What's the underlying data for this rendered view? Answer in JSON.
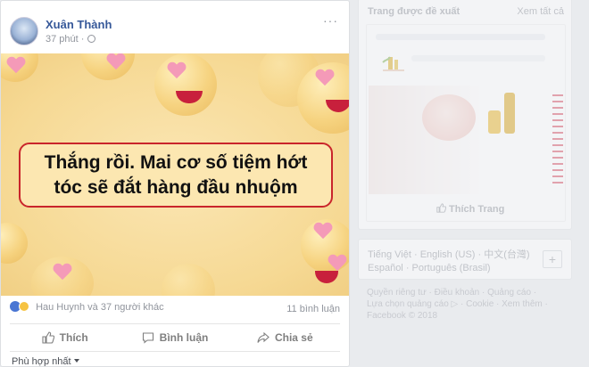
{
  "post": {
    "author": "Xuân Thành",
    "time": "37 phút",
    "more": "···",
    "caption_line1": "Thắng rồi. Mai cơ số tiệm hớt",
    "caption_line2": "tóc sẽ đắt hàng đầu nhuộm",
    "reactions_text": "Hau Huynh và 37 người khác",
    "comments_count": "11 bình luận",
    "actions": {
      "like": "Thích",
      "comment": "Bình luận",
      "share": "Chia sẻ"
    },
    "sort_label": "Phù hợp nhất"
  },
  "sidebar": {
    "suggested_title": "Trang được đề xuất",
    "see_all": "Xem tất cả",
    "like_page": "Thích Trang",
    "languages": {
      "vi": "Tiếng Việt",
      "en": "English (US)",
      "zh": "中文(台灣)",
      "es": "Español",
      "pt": "Português (Brasil)"
    },
    "footer": {
      "line1": "Quyền riêng tư · Điều khoản · Quảng cáo ·",
      "line2": "Lựa chọn quảng cáo ▷ · Cookie · Xem thêm ·",
      "line3": "Facebook © 2018"
    }
  },
  "colors": {
    "link": "#365899",
    "muted": "#90949c",
    "caption_border": "#c9252b",
    "image_bg": "#f6d994"
  }
}
